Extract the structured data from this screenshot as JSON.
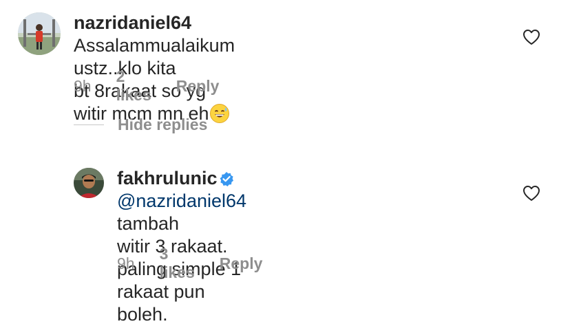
{
  "comment1": {
    "username": "nazridaniel64",
    "line1": "Assalammualaikum ustz..klo kita",
    "line2": "bt 8rakaat so yg witir mcm mn eh",
    "emoji_icon": "grinning-sweat-emoji",
    "time": "9h",
    "likes": "2 likes",
    "reply": "Reply"
  },
  "hide_replies": "Hide replies",
  "reply1": {
    "username": "fakhrulunic",
    "verified_icon": "verified-badge-icon",
    "mention": "@nazridaniel64",
    "line1_rest": " tambah",
    "line2": "witir 3 rakaat. paling simple 1 rakaat pun",
    "line3": "boleh.",
    "time": "9h",
    "likes": "3 likes",
    "reply": "Reply"
  },
  "colors": {
    "text": "#262626",
    "secondary": "#8e8e8e",
    "mention": "#00376b",
    "verified": "#3897f0"
  }
}
